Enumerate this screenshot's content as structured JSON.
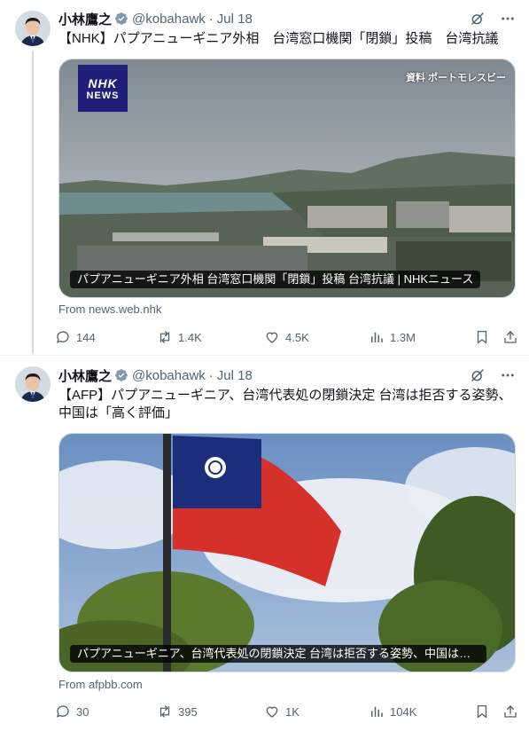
{
  "tweets": [
    {
      "author": "小林鷹之",
      "handle": "@kobahawk",
      "date": "Jul 18",
      "text": "【NHK】パプアニューギニア外相　台湾窓口機関「閉鎖」投稿　台湾抗議",
      "card": {
        "logo_top": "NHK",
        "logo_bottom": "NEWS",
        "source_tag": "資料 ポートモレスビー",
        "caption": "パプアニューギニア外相 台湾窓口機関「閉鎖」投稿 台湾抗議 | NHKニュース"
      },
      "from": "From news.web.nhk",
      "stats": {
        "replies": "144",
        "reposts": "1.4K",
        "likes": "4.5K",
        "views": "1.3M"
      }
    },
    {
      "author": "小林鷹之",
      "handle": "@kobahawk",
      "date": "Jul 18",
      "text": "【AFP】パプアニューギニア、台湾代表処の閉鎖決定 台湾は拒否する姿勢、中国は「高く評価」",
      "card": {
        "caption": "パプアニューギニア、台湾代表処の閉鎖決定 台湾は拒否する姿勢、中国は「高く評価」"
      },
      "from": "From afpbb.com",
      "stats": {
        "replies": "30",
        "reposts": "395",
        "likes": "1K",
        "views": "104K"
      }
    }
  ],
  "colors": {
    "text": "#0f1419",
    "muted": "#536471",
    "verified": "#829aab",
    "border": "#cfd9de"
  }
}
